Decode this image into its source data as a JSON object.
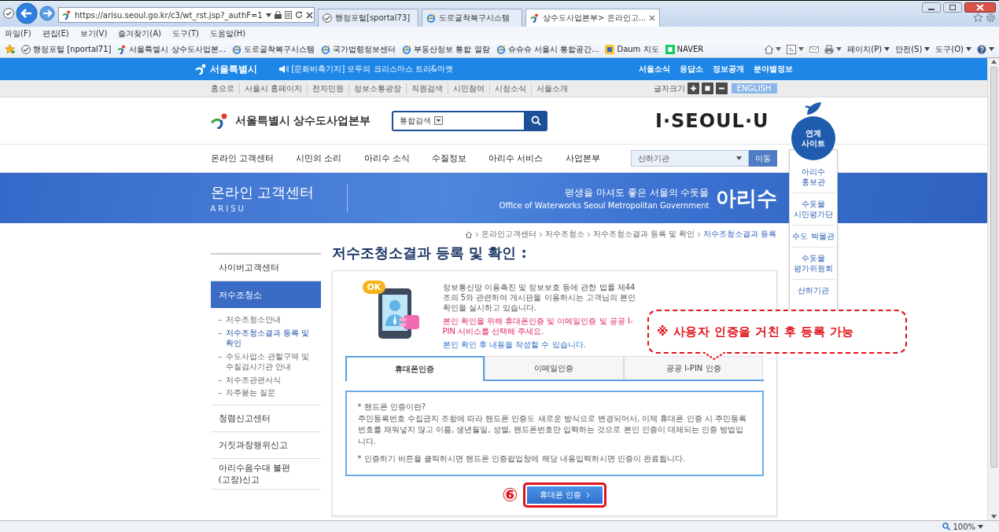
{
  "browser": {
    "address": "https://arisu.seoul.go.kr/c3/wt_rst.jsp?_authF=1",
    "tabs": [
      {
        "label": "행정포털[sportal73]",
        "kind": "portal",
        "selected": false
      },
      {
        "label": "도로굴착복구시스템",
        "kind": "ie",
        "selected": false
      },
      {
        "label": "상수도사업본부> 온라인고...",
        "kind": "seoul",
        "selected": true
      }
    ],
    "menu": [
      "파일(F)",
      "편집(E)",
      "보기(V)",
      "즐겨찾기(A)",
      "도구(T)",
      "도움말(H)"
    ],
    "favorites": [
      {
        "label": "행정포털 [nportal71]",
        "kind": "portal"
      },
      {
        "label": "서울특별시 상수도사업본...",
        "kind": "seoul"
      },
      {
        "label": "도로굴착복구시스템",
        "kind": "ie"
      },
      {
        "label": "국가법령정보센터",
        "kind": "ie"
      },
      {
        "label": "부동산정보 통합 열람",
        "kind": "ie"
      },
      {
        "label": "슈슈슈 서울시 통합공간...",
        "kind": "ie"
      },
      {
        "label": "Daum 지도",
        "kind": "daum"
      },
      {
        "label": "NAVER",
        "kind": "naver"
      }
    ],
    "commands": [
      "페이지(P)",
      "안전(S)",
      "도구(O)"
    ]
  },
  "site": {
    "top_bar": {
      "logo": "서울특별시",
      "notice": "[문화비축기지] 모두의 크리스마스 트리&마켓",
      "links": [
        "서울소식",
        "응답소",
        "정보공개",
        "분야별정보"
      ]
    },
    "util_bar": {
      "links": [
        "홈으로",
        "서울시 홈페이지",
        "전자민원",
        "정보소통광장",
        "직원검색",
        "시민참여",
        "시정소식",
        "서울소개"
      ],
      "font_size_label": "글자크기",
      "english": "ENGLISH"
    },
    "header": {
      "logo": "서울특별시 상수도사업본부",
      "search_scope": "통합검색",
      "slogan": "I·SEOUL·U"
    },
    "nav": {
      "items": [
        "온라인 고객센터",
        "시민의 소리",
        "아리수 소식",
        "수질정보",
        "아리수 서비스",
        "사업본부"
      ],
      "agency_select": "산하기관",
      "go_button": "이동"
    },
    "banner": {
      "title": "온라인 고객센터",
      "subtitle": "ARISU",
      "slogan": "평생을 마셔도 좋은 서울의 수돗물",
      "slogan_en": "Office of Waterworks Seoul Metropolitan Government",
      "brand": "아리수"
    },
    "related_sites": {
      "title": "연계 사이트",
      "items": [
        "아리수 홍보관",
        "수돗물 시민평가단",
        "수도 박물관",
        "수돗물 평가위원회",
        "산하기관"
      ]
    },
    "breadcrumb": [
      {
        "label": "온라인고객센터",
        "selected": false
      },
      {
        "label": "저수조청소",
        "selected": false
      },
      {
        "label": "저수조청소결과 등록 및 확인",
        "selected": false
      },
      {
        "label": "저수조청소결과 등록",
        "selected": true
      }
    ],
    "sidebar": [
      {
        "label": "사이버고객센터",
        "selected": false
      },
      {
        "label": "저수조청소",
        "selected": true,
        "children": [
          {
            "label": "저수조청소안내",
            "selected": false
          },
          {
            "label": "저수조청소결과 등록 및 확인",
            "selected": true
          },
          {
            "label": "수도사업소 관할구역 및 수질검사기관 안내",
            "selected": false
          },
          {
            "label": "저수조관련서식",
            "selected": false
          },
          {
            "label": "자주묻는 질문",
            "selected": false
          }
        ]
      },
      {
        "label": "청렴신고센터",
        "selected": false
      },
      {
        "label": "거짓과장행위신고",
        "selected": false
      },
      {
        "label": "아리수음수대 불편(고장)신고",
        "selected": false
      }
    ],
    "page_title": "저수조청소결과 등록 및 확인 :",
    "auth": {
      "badge": "OK",
      "intro": "정보통신망 이용촉진 및 정보보호 등에 관한 법률 제44조의 5와 관련하여 게시판을 이용하시는 고객님의 본인 확인을 실시하고 있습니다.",
      "notice": "본인 확인을 위해 휴대폰인증 및 이메일인증 및 공공 I-PIN 서비스를 선택해 주세요.",
      "hint": "본인 확인 후 내용을 작성할 수 있습니다.",
      "tabs": [
        {
          "label": "휴대폰인증",
          "selected": true
        },
        {
          "label": "이메일인증",
          "selected": false
        },
        {
          "label": "공공 I-PIN 인증",
          "selected": false
        }
      ],
      "description": [
        {
          "heading": "* 핸드폰 인증이란?",
          "body": "주민등록번호 수집금지 조항에 따라 핸드폰 인증도 새로운 방식으로 변경되어서, 이제 휴대폰 인증 시 주민등록번호를 채워넣지 않고 이름, 생년월일, 성별, 핸드폰번호만 입력하는 것으로 본인 인증이 대체되는 인증 방법입니다."
        },
        {
          "heading": "* 인증하기 버튼을 클릭하시면 핸드폰 인증팝업창에 해당 내용입력하시면 인증이 완료됩니다."
        }
      ],
      "button": "휴대폰 인증"
    }
  },
  "annotations": {
    "step": "⑥",
    "callout": "※ 사용자 인증을 거친 후 등록 가능"
  },
  "status_bar": {
    "zoom": "100%"
  }
}
